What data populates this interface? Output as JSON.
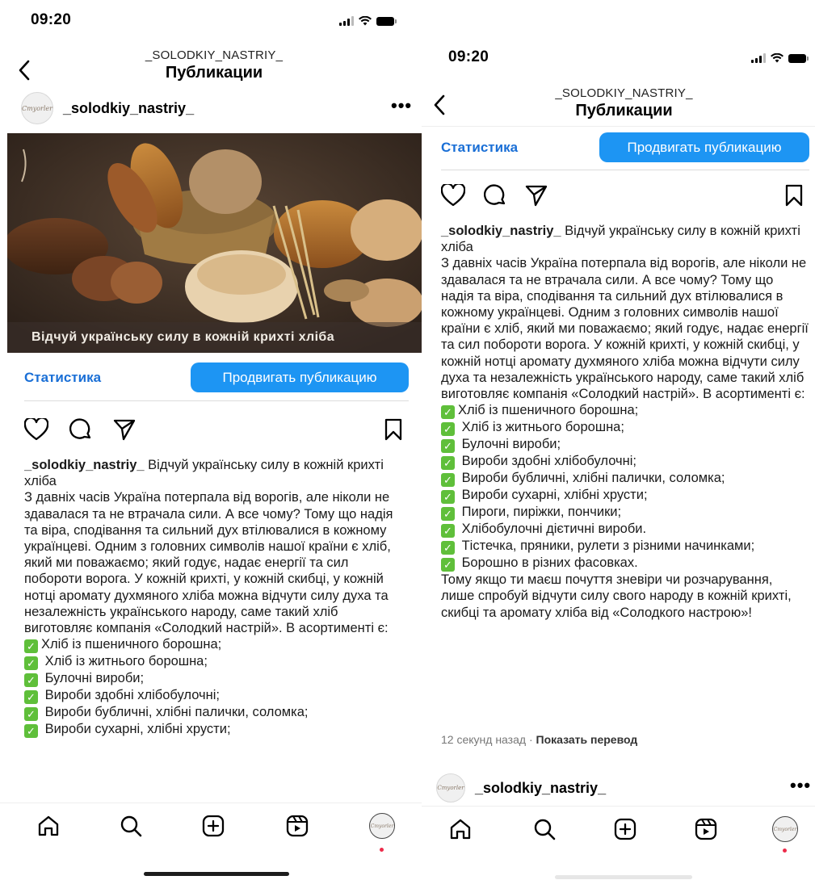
{
  "left": {
    "status": {
      "time": "09:20"
    },
    "header": {
      "subtitle": "_SOLODKIY_NASTRIY_",
      "title": "Публикации"
    },
    "post": {
      "username": "_solodkiy_nastriy_",
      "avatar_text": "Cmyorler",
      "more_label": "•••",
      "image_caption": "Відчуй українську силу в кожній крихті хліба",
      "stats_label": "Статистика",
      "promote_label": "Продвигать публикацию",
      "caption": {
        "username": "_solodkiy_nastriy_",
        "headline": " Відчуй українську силу в кожній крихті хліба",
        "body": "З давніх часів Україна потерпала від ворогів, але ніколи не здавалася та не втрачала сили. А все чому? Тому що надія та віра, сподівання та сильний дух втілювалися в кожному українцеві. Одним з головних символів нашої країни є хліб, який ми поважаємо; який годує, надає енергії та сил побороти ворога. У кожній крихті, у кожній скибці, у кожній нотці аромату духмяного хліба можна відчути силу духа та незалежність українського народу, саме такий хліб виготовляє компанія «Солодкий настрій». В асортименті є:",
        "items": [
          "Хліб із пшеничного борошна;",
          " Хліб із житнього борошна;",
          " Булочні вироби;",
          " Вироби здобні хлібобулочні;",
          " Вироби бубличні, хлібні палички, соломка;",
          " Вироби сухарні, хлібні хрусти;"
        ]
      }
    }
  },
  "right": {
    "status": {
      "time": "09:20"
    },
    "header": {
      "subtitle": "_SOLODKIY_NASTRIY_",
      "title": "Публикации"
    },
    "post": {
      "stats_label": "Статистика",
      "promote_label": "Продвигать публикацию",
      "caption": {
        "username": "_solodkiy_nastriy_",
        "headline": " Відчуй українську силу в кожній крихті хліба",
        "body": "З давніх часів Україна потерпала від ворогів, але ніколи не здавалася та не втрачала сили. А все чому? Тому що надія та віра, сподівання та сильний дух втілювалися в кожному українцеві. Одним з головних символів нашої країни є хліб, який ми поважаємо; який годує, надає енергії та сил побороти ворога. У кожній крихті, у кожній скибці, у кожній нотці аромату духмяного хліба можна відчути силу духа та незалежність українського народу, саме такий хліб виготовляє компанія «Солодкий настрій». В асортименті є:",
        "items": [
          "Хліб із пшеничного борошна;",
          " Хліб із житнього борошна;",
          " Булочні вироби;",
          " Вироби здобні хлібобулочні;",
          " Вироби бубличні, хлібні палички, соломка;",
          " Вироби сухарні, хлібні хрусти;",
          " Пироги, пиріжки, пончики;",
          " Хлібобулочні дієтичні вироби.",
          " Тістечка, пряники, рулети з різними начинками;",
          " Борошно в різних фасовках."
        ],
        "closing": "Тому якщо ти маєш почуття зневіри чи розчарування, лише спробуй відчути силу свого народу в кожній крихті, скибці та аромату хліба від «Солодкого настрою»!"
      },
      "timestamp": "12 секунд назад",
      "separator": " · ",
      "translate_label": "Показать перевод"
    },
    "next_post": {
      "username": "_solodkiy_nastriy_",
      "avatar_text": "Cmyorler",
      "more_label": "•••"
    }
  },
  "icons": {
    "back": "chevron-left-icon",
    "like": "heart-icon",
    "comment": "comment-bubble-icon",
    "share": "paper-plane-icon",
    "save": "bookmark-icon",
    "tabs": [
      "home-icon",
      "search-icon",
      "create-post-icon",
      "reels-icon",
      "profile-avatar-icon"
    ]
  },
  "colors": {
    "accent": "#1d95f3",
    "link": "#1a6fd6",
    "check": "#5fbf3a",
    "notification": "#ed2b4a"
  }
}
